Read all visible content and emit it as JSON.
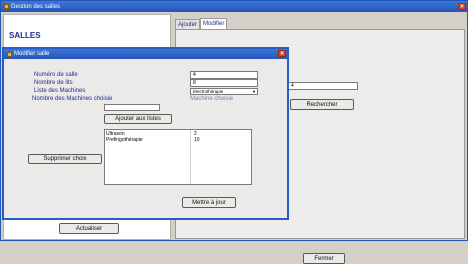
{
  "main_window": {
    "title": "Gestion des salles",
    "close_glyph": "×",
    "heading": "SALLES",
    "tabs": [
      {
        "label": "Ajouter"
      },
      {
        "label": "Modifier"
      }
    ],
    "search_value": "4",
    "search_button": "Rechercher",
    "refresh_button": "Actualiser",
    "close_button": "Fermer"
  },
  "dialog": {
    "title": "Modifier salle",
    "close_glyph": "×",
    "labels": {
      "room_number": "Numéro de salle",
      "bed_count": "Nombre de lits",
      "machine_list": "Liste des Machines",
      "machine_count": "Nombre des Machines choisie",
      "machine_chosen": "Machine choisie"
    },
    "values": {
      "room_number": "4",
      "bed_count": "8",
      "machine_select": "Electrothérapie",
      "machine_count": ""
    },
    "add_button": "Ajouter aux listes",
    "remove_button": "Supprimer choix",
    "update_button": "Mettre à jour",
    "machines": [
      "Ultrason",
      "Prefingothérapie"
    ],
    "counts": [
      "2",
      "10"
    ]
  },
  "colors": {
    "titlebar": "#2456b8",
    "dialog_border": "#2a5cc8",
    "label_text": "#1f2d8a"
  }
}
